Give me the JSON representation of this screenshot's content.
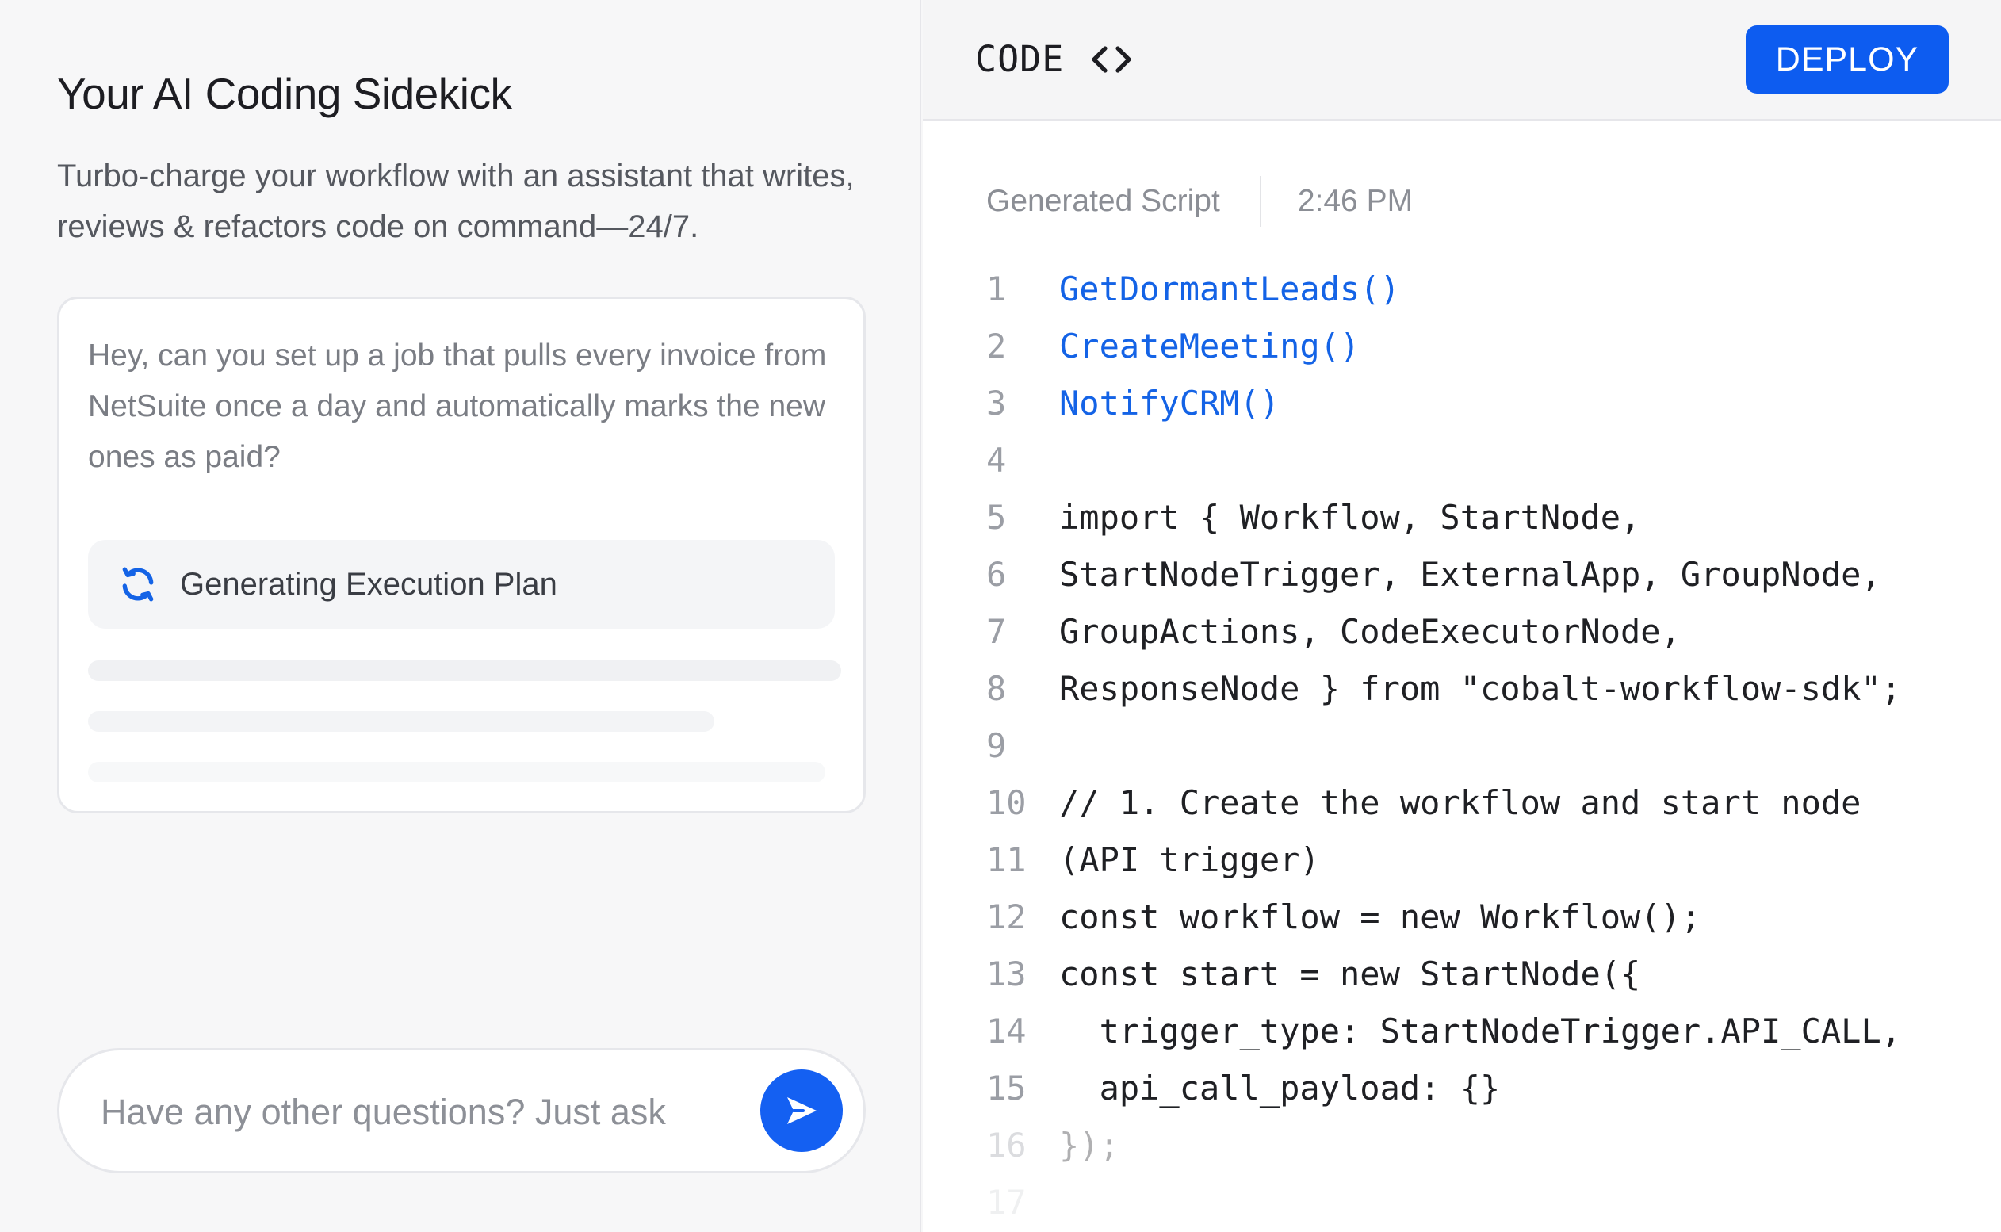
{
  "left": {
    "title": "Your AI Coding Sidekick",
    "subtitle": "Turbo-charge your workflow with an assistant that writes, reviews & refactors code on command—24/7.",
    "prompt": "Hey, can you set up a job that pulls every invoice from NetSuite once a day and automatically marks the new ones as paid?",
    "status": "Generating Execution Plan",
    "chat": {
      "placeholder": "Have any other questions? Just ask"
    }
  },
  "right": {
    "header": {
      "title": "CODE",
      "deploy_label": "DEPLOY"
    },
    "meta": {
      "label": "Generated Script",
      "time": "2:46 PM"
    },
    "lines": [
      {
        "n": "1",
        "code": "GetDormantLeads()"
      },
      {
        "n": "2",
        "code": "CreateMeeting()"
      },
      {
        "n": "3",
        "code": "NotifyCRM()"
      },
      {
        "n": "4",
        "code": ""
      },
      {
        "n": "5",
        "code": "import { Workflow, StartNode,"
      },
      {
        "n": "6",
        "code": "StartNodeTrigger, ExternalApp, GroupNode,"
      },
      {
        "n": "7",
        "code": "GroupActions, CodeExecutorNode,"
      },
      {
        "n": "8",
        "code": "ResponseNode } from \"cobalt-workflow-sdk\";"
      },
      {
        "n": "9",
        "code": ""
      },
      {
        "n": "10",
        "code": "// 1. Create the workflow and start node"
      },
      {
        "n": "11",
        "code": "(API trigger)"
      },
      {
        "n": "12",
        "code": "const workflow = new Workflow();"
      },
      {
        "n": "13",
        "code": "const start = new StartNode({"
      },
      {
        "n": "14",
        "code": "  trigger_type: StartNodeTrigger.API_CALL,"
      },
      {
        "n": "15",
        "code": "  api_call_payload: {}"
      },
      {
        "n": "16",
        "code": "});"
      },
      {
        "n": "17",
        "code": ""
      }
    ]
  },
  "colors": {
    "accent": "#0d5cf0",
    "function_call": "#1463e6",
    "background": "#f7f7f8"
  }
}
